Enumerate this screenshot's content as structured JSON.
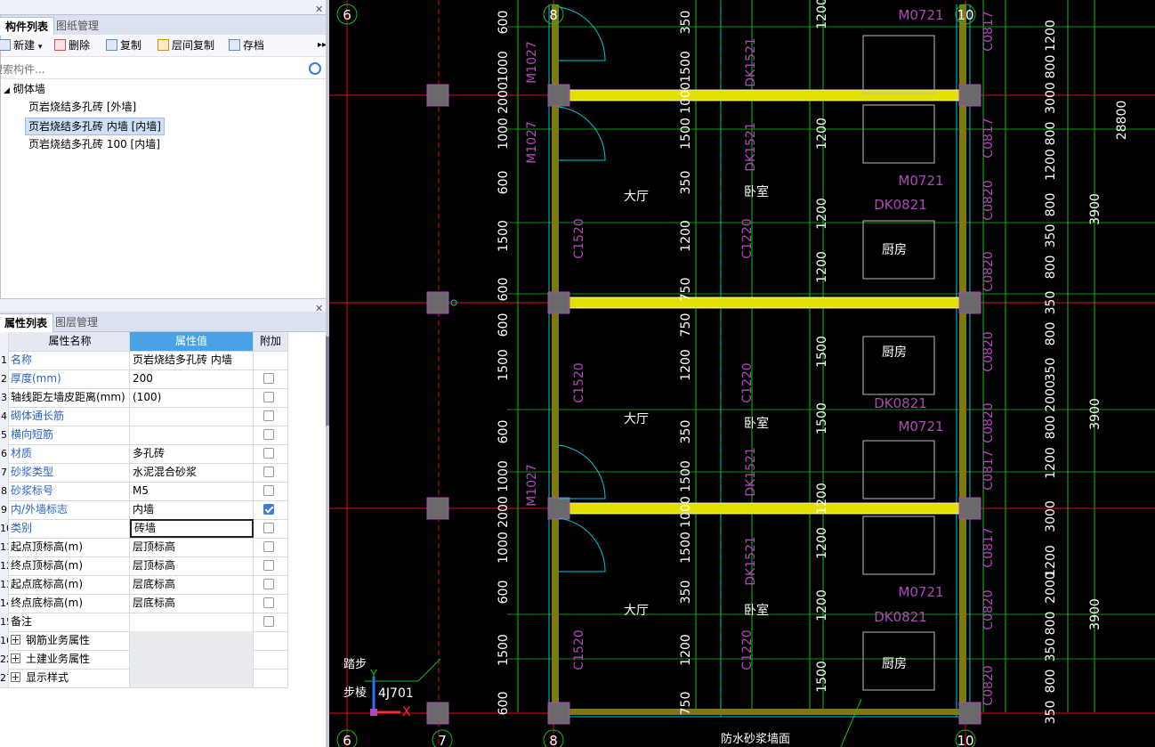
{
  "component_panel": {
    "tabs": [
      "构件列表",
      "图纸管理"
    ],
    "toolbar": {
      "new_label": "新建",
      "delete_label": "删除",
      "copy_label": "复制",
      "floor_copy_label": "层间复制",
      "archive_label": "存档"
    },
    "search_placeholder": "搜索构件...",
    "tree": {
      "category": "砌体墙",
      "items": [
        {
          "label": "页岩烧结多孔砖 [外墙]",
          "selected": false
        },
        {
          "label": "页岩烧结多孔砖 内墙 [内墙]",
          "selected": true
        },
        {
          "label": "页岩烧结多孔砖 100 [内墙]",
          "selected": false
        }
      ]
    }
  },
  "property_panel": {
    "tabs": [
      "属性列表",
      "图层管理"
    ],
    "headers": {
      "name": "属性名称",
      "value": "属性值",
      "extra": "附加"
    },
    "rows": [
      {
        "index": "1",
        "name": "名称",
        "value": "页岩烧结多孔砖 内墙",
        "blue": true,
        "checkbox": false,
        "checked": false
      },
      {
        "index": "2",
        "name": "厚度(mm)",
        "value": "200",
        "blue": true,
        "checkbox": true,
        "checked": false
      },
      {
        "index": "3",
        "name": "轴线距左墙皮距离(mm)",
        "value": "(100)",
        "blue": false,
        "checkbox": true,
        "checked": false
      },
      {
        "index": "4",
        "name": "砌体通长筋",
        "value": "",
        "blue": true,
        "checkbox": true,
        "checked": false
      },
      {
        "index": "5",
        "name": "横向短筋",
        "value": "",
        "blue": true,
        "checkbox": true,
        "checked": false
      },
      {
        "index": "6",
        "name": "材质",
        "value": "多孔砖",
        "blue": true,
        "checkbox": true,
        "checked": false
      },
      {
        "index": "7",
        "name": "砂浆类型",
        "value": "水泥混合砂浆",
        "blue": true,
        "checkbox": true,
        "checked": false
      },
      {
        "index": "8",
        "name": "砂浆标号",
        "value": "M5",
        "blue": true,
        "checkbox": true,
        "checked": false
      },
      {
        "index": "9",
        "name": "内/外墙标志",
        "value": "内墙",
        "blue": true,
        "checkbox": true,
        "checked": true
      },
      {
        "index": "10",
        "name": "类别",
        "value": "砖墙",
        "blue": true,
        "checkbox": true,
        "checked": false
      },
      {
        "index": "11",
        "name": "起点顶标高(m)",
        "value": "层顶标高",
        "blue": false,
        "checkbox": true,
        "checked": false
      },
      {
        "index": "12",
        "name": "终点顶标高(m)",
        "value": "层顶标高",
        "blue": false,
        "checkbox": true,
        "checked": false
      },
      {
        "index": "13",
        "name": "起点底标高(m)",
        "value": "层底标高",
        "blue": false,
        "checkbox": true,
        "checked": false
      },
      {
        "index": "14",
        "name": "终点底标高(m)",
        "value": "层底标高",
        "blue": false,
        "checkbox": true,
        "checked": false
      },
      {
        "index": "15",
        "name": "备注",
        "value": "",
        "blue": false,
        "checkbox": true,
        "checked": false
      }
    ],
    "groups": [
      {
        "index": "16",
        "name": "钢筋业务属性"
      },
      {
        "index": "22",
        "name": "土建业务属性"
      },
      {
        "index": "27",
        "name": "显示样式"
      }
    ]
  },
  "cad": {
    "axis_labels": [
      "6",
      "8",
      "10",
      "6",
      "7",
      "8",
      "10"
    ],
    "room_labels": [
      "大厅",
      "卧室",
      "厨房",
      "大厅",
      "卧室",
      "厨房",
      "大厅",
      "卧室",
      "厨房"
    ],
    "door_labels": [
      "M1027",
      "M1027",
      "M1027",
      "DK1521",
      "DK1521",
      "DK1521",
      "DK1521",
      "M0721",
      "M0721",
      "M0721",
      "M0721",
      "DK0821",
      "DK0821",
      "DK0821"
    ],
    "window_labels": [
      "C1520",
      "C1520",
      "C1520",
      "C1220",
      "C1220",
      "C1220",
      "C0817",
      "C0817",
      "C0817",
      "C0817",
      "C0820",
      "C0820",
      "C0820",
      "C0820",
      "C0820",
      "C0820"
    ],
    "dims_left": [
      "600",
      "1000",
      "2000",
      "1000",
      "600",
      "1500",
      "600",
      "600",
      "1500",
      "600",
      "1000",
      "2000",
      "1000",
      "600",
      "1500",
      "600"
    ],
    "dims_mid": [
      "350",
      "1500",
      "1000",
      "1500",
      "350",
      "1200",
      "750",
      "750",
      "1200",
      "350",
      "1500",
      "1000",
      "1500",
      "350",
      "1200",
      "750"
    ],
    "dims_right": [
      "1200",
      "1200",
      "1200",
      "1200",
      "1500",
      "1500",
      "1200",
      "1200",
      "1200",
      "1500",
      "1500"
    ],
    "dims_far": [
      "1200",
      "800",
      "3000",
      "800",
      "1200",
      "800",
      "350",
      "800",
      "350",
      "800",
      "350",
      "2000",
      "800",
      "1200",
      "3000",
      "1200",
      "2000",
      "800",
      "350",
      "800",
      "350"
    ],
    "dims_outer": [
      "28800",
      "3900",
      "3900",
      "3900"
    ],
    "annot_step": "踏步",
    "annot_step2": "步棱",
    "annot_ref": "4J701",
    "annot_bottom": "防水砂浆墙面",
    "ucs_y": "Y",
    "ucs_x": "X",
    "colors": {
      "wall": "#e4e000",
      "column": "#6a6a6a",
      "axis": "#d11",
      "green": "#10c010",
      "magenta": "#b048b8",
      "cyan": "#00c8d8"
    }
  }
}
